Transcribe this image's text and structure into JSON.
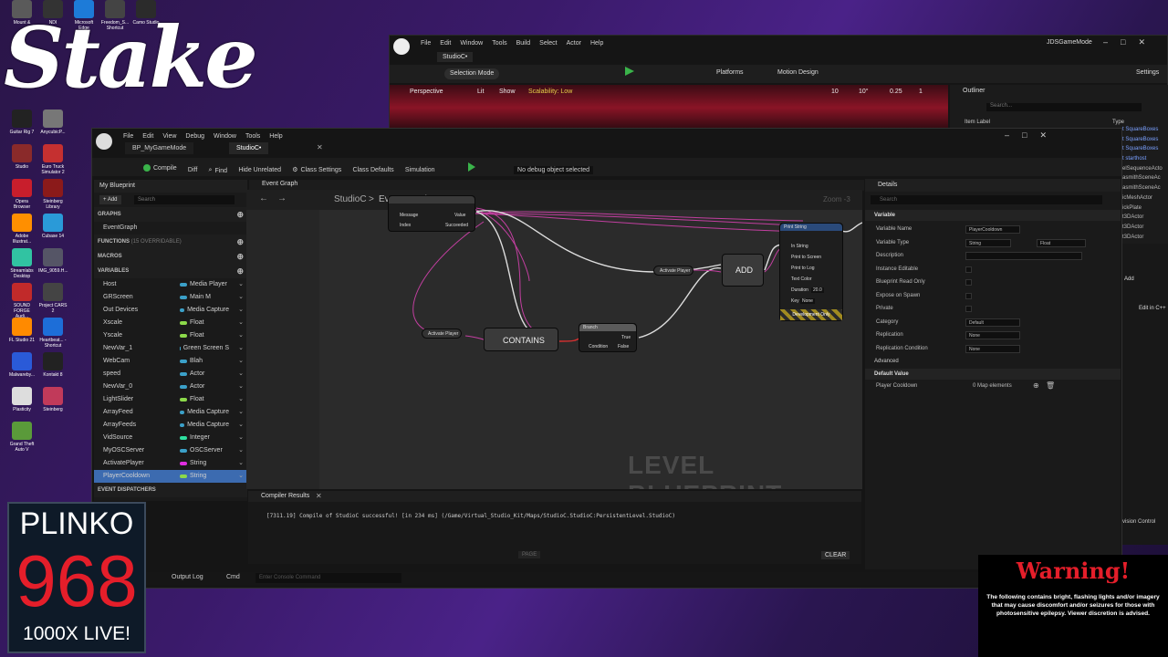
{
  "desktop": {
    "icons": [
      {
        "label": "Mount &",
        "color": "#5a5a5a"
      },
      {
        "label": "NDI",
        "color": "#333"
      },
      {
        "label": "Microsoft Edge",
        "color": "#1d7bd8"
      },
      {
        "label": "Freedom_S... Shortcut",
        "color": "#444"
      },
      {
        "label": "Camo Studio",
        "color": "#2b2b2b"
      },
      {
        "label": "Guitar Rig 7",
        "color": "#222"
      },
      {
        "label": "AnycubicP...",
        "color": "#777"
      },
      {
        "label": "Studio",
        "color": "#8a2a2a"
      },
      {
        "label": "Euro Truck Simulator 2",
        "color": "#c53030"
      },
      {
        "label": "Opera Browser",
        "color": "#c81e2c"
      },
      {
        "label": "Steinberg Library",
        "color": "#8b1a1a"
      },
      {
        "label": "Adobe Illustrat...",
        "color": "#ff8f00"
      },
      {
        "label": "Cubase 14",
        "color": "#2a9ad8"
      },
      {
        "label": "Streamlabs Desktop",
        "color": "#31c3a2"
      },
      {
        "label": "IMG_9059.H...",
        "color": "#556"
      },
      {
        "label": "SOUND FORGE Audi...",
        "color": "#c12a2a"
      },
      {
        "label": "Project CARS 2",
        "color": "#444"
      },
      {
        "label": "FL Studio 21",
        "color": "#ff8a00"
      },
      {
        "label": "Heartbeat... - Shortcut",
        "color": "#1d6ed8"
      },
      {
        "label": "Malwareby...",
        "color": "#2a5ad8"
      },
      {
        "label": "Kontakt 8",
        "color": "#222"
      },
      {
        "label": "Plasticity",
        "color": "#ddd"
      },
      {
        "label": "Steinberg",
        "color": "#c13a5a"
      },
      {
        "label": "Grand Theft Auto V",
        "color": "#5a9a3a"
      }
    ],
    "stake_logo": "Stake"
  },
  "back_window": {
    "menu": [
      "File",
      "Edit",
      "Window",
      "Tools",
      "Build",
      "Select",
      "Actor",
      "Help"
    ],
    "title": "JDSGameMode",
    "tab": "StudioC•",
    "toolbar": {
      "selection_mode": "Selection Mode",
      "platforms": "Platforms",
      "motion_design": "Motion Design",
      "settings": "Settings"
    },
    "viewport": {
      "perspective": "Perspective",
      "lit": "Lit",
      "show": "Show",
      "scalability": "Scalability: Low",
      "grid": "10",
      "angle": "10°",
      "scale": "0.25",
      "cam": "1"
    },
    "outliner": {
      "title": "Outliner",
      "search": "Search...",
      "col_label": "Item Label",
      "col_type": "Type",
      "types": [
        "t SquareBoxes",
        "t SquareBoxes",
        "t SquareBoxes",
        "t starthost",
        "elSequenceActo",
        "asmithSceneAc",
        "asmithSceneAc",
        "icMeshActor",
        "ickPlate",
        "t3DActor",
        "t3DActor",
        "t3DActor"
      ]
    }
  },
  "bp_window": {
    "menu": [
      "File",
      "Edit",
      "View",
      "Debug",
      "Window",
      "Tools",
      "Help"
    ],
    "tabs": [
      "BP_MyGameMode",
      "StudioC•"
    ],
    "toolbar": {
      "compile": "Compile",
      "diff": "Diff",
      "find": "Find",
      "hide_unrelated": "Hide Unrelated",
      "class_settings": "Class Settings",
      "class_defaults": "Class Defaults",
      "simulation": "Simulation",
      "debug_object": "No debug object selected"
    },
    "my_blueprint": {
      "title": "My Blueprint",
      "add": "Add",
      "search_placeholder": "Search",
      "graphs_label": "GRAPHS",
      "event_graph": "EventGraph",
      "functions_label": "FUNCTIONS",
      "functions_count": "(15 OVERRIDABLE)",
      "macros_label": "MACROS",
      "variables_label": "VARIABLES",
      "event_dispatchers_label": "EVENT DISPATCHERS",
      "variables": [
        {
          "name": "Host",
          "type": "Media Player",
          "color": "#3ba0c8"
        },
        {
          "name": "GRScreen",
          "type": "Main M",
          "color": "#3ba0c8"
        },
        {
          "name": "Out Devices",
          "type": "Media Capture",
          "color": "#3ba0c8"
        },
        {
          "name": "Xscale",
          "type": "Float",
          "color": "#8cd94a"
        },
        {
          "name": "Yscale",
          "type": "Float",
          "color": "#8cd94a"
        },
        {
          "name": "NewVar_1",
          "type": "Green Screen S",
          "color": "#3ba0c8"
        },
        {
          "name": "WebCam",
          "type": "Blah",
          "color": "#3ba0c8"
        },
        {
          "name": "speed",
          "type": "Actor",
          "color": "#3ba0c8"
        },
        {
          "name": "NewVar_0",
          "type": "Actor",
          "color": "#3ba0c8"
        },
        {
          "name": "LightSlider",
          "type": "Float",
          "color": "#8cd94a"
        },
        {
          "name": "ArrayFeed",
          "type": "Media Capture",
          "color": "#3ba0c8"
        },
        {
          "name": "ArrayFeeds",
          "type": "Media Capture",
          "color": "#3ba0c8"
        },
        {
          "name": "VidSource",
          "type": "Integer",
          "color": "#2ee0a0"
        },
        {
          "name": "MyOSCServer",
          "type": "OSCServer",
          "color": "#3ba0c8"
        },
        {
          "name": "ActivatePlayer",
          "type": "String",
          "color": "#e02ee0"
        },
        {
          "name": "PlayerCooldown",
          "type": "String",
          "color": "#8cd94a"
        }
      ]
    },
    "graph": {
      "tab": "Event Graph",
      "breadcrumb_root": "StudioC",
      "breadcrumb_sep": ">",
      "breadcrumb_current": "Event Graph",
      "zoom": "Zoom -3",
      "watermark": "LEVEL BLUEPRINT",
      "nodes": {
        "contains": "CONTAINS",
        "add": "ADD",
        "branch": "Branch",
        "print_string": "Print String",
        "activate_player_1": "Activate Player",
        "activate_player_2": "Activate Player",
        "in_string": "In String",
        "print_to_screen": "Print to Screen",
        "print_to_log": "Print to Log",
        "text_color": "Text Color",
        "duration": "Duration",
        "duration_val": "20.0",
        "key": "Key",
        "key_val": "None",
        "dev_only": "Development Only",
        "true": "True",
        "false": "False",
        "condition": "Condition",
        "message": "Message",
        "value": "Value",
        "succeeded": "Succeeded",
        "index": "Index"
      }
    },
    "compiler": {
      "tab": "Compiler Results",
      "message": "[7311.19] Compile of StudioC successful! [in 234 ms] (/Game/Virtual_Studio_Kit/Maps/StudioC.StudioC:PersistentLevel.StudioC)",
      "page": "PAGE",
      "clear": "CLEAR"
    },
    "statusbar": {
      "output_log": "Output Log",
      "cmd": "Cmd",
      "console_placeholder": "Enter Console Command"
    },
    "details": {
      "title": "Details",
      "search_placeholder": "Search",
      "section_variable": "Variable",
      "rows": [
        {
          "label": "Variable Name",
          "value": "PlayerCooldown"
        },
        {
          "label": "Variable Type",
          "value": "String"
        },
        {
          "label": "Description",
          "value": ""
        },
        {
          "label": "Instance Editable",
          "value": ""
        },
        {
          "label": "Blueprint Read Only",
          "value": ""
        },
        {
          "label": "Expose on Spawn",
          "value": ""
        },
        {
          "label": "Private",
          "value": ""
        },
        {
          "label": "Category",
          "value": "Default"
        },
        {
          "label": "Replication",
          "value": "None"
        },
        {
          "label": "Replication Condition",
          "value": "None"
        }
      ],
      "value_type2": "Float",
      "section_advanced": "Advanced",
      "section_default": "Default Value",
      "default_label": "Player Cooldown",
      "default_value": "0 Map elements",
      "right_add": "Add",
      "edit_in_cpp": "Edit in C++",
      "vision_control": "vision Control"
    }
  },
  "overlays": {
    "plinko": {
      "title": "PLINKO",
      "number": "968",
      "subtitle": "1000X LIVE!"
    },
    "warning": {
      "title": "Warning!",
      "text": "The following contains bright, flashing lights and/or imagery that may cause discomfort and/or seizures for those with photosensitive epilepsy. Viewer discretion is advised."
    }
  }
}
